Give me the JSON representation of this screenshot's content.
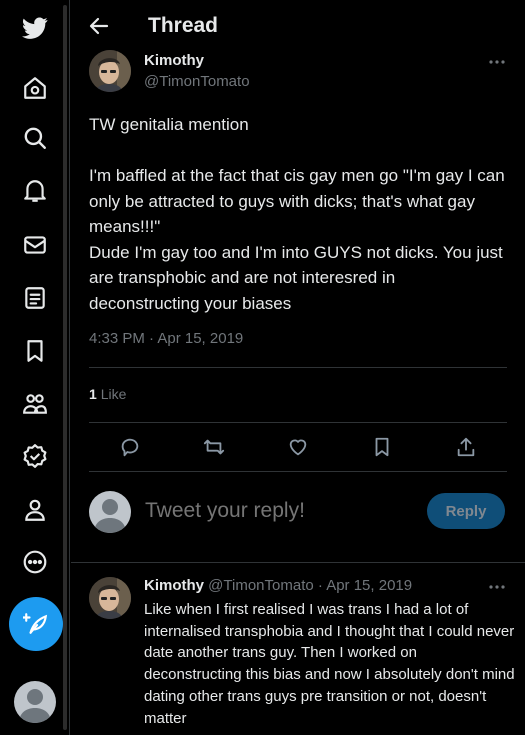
{
  "header": {
    "title": "Thread"
  },
  "nav": {
    "items": [
      "twitter-logo",
      "home",
      "explore",
      "notifications",
      "messages",
      "lists",
      "bookmarks",
      "communities",
      "verified",
      "profile",
      "more"
    ]
  },
  "tweet": {
    "author_name": "Kimothy",
    "author_handle": "@TimonTomato",
    "paragraphs": [
      "TW genitalia mention",
      "I'm baffled at the fact that cis gay men go \"I'm gay I can only be attracted to guys with dicks; that's what gay means!!!\"",
      "Dude I'm gay too and I'm into GUYS not dicks. You just are transphobic and are not interesred in deconstructing your biases"
    ],
    "timestamp": "4:33 PM · Apr 15, 2019",
    "like_count": "1",
    "like_label": "Like"
  },
  "reply_box": {
    "placeholder": "Tweet your reply!",
    "button_label": "Reply"
  },
  "reply": {
    "author_name": "Kimothy",
    "meta": "@TimonTomato · Apr 15, 2019",
    "text": "Like when I first realised I was trans I had a lot of internalised transphobia and I thought that I could never date another trans guy. Then I worked on deconstructing this bias and now I absolutely don't mind dating other trans guys pre transition or not, doesn't matter"
  },
  "colors": {
    "accent": "#1d9bf0",
    "background": "#000000",
    "muted": "#71767b",
    "text": "#e7e9ea",
    "reply_button": "#0f4e78"
  }
}
